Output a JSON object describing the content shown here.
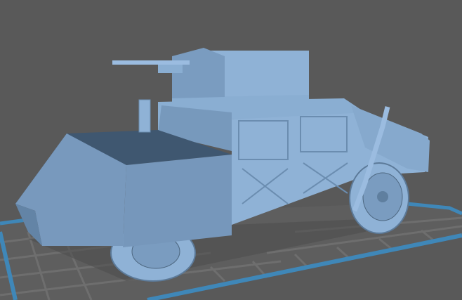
{
  "viewport": {
    "background_color": "#595959",
    "plate_border_color": "#3f87b8",
    "plate_grid_color": "#6b6b6b",
    "model_color_light": "#8fb2d6",
    "model_color_mid": "#7899bd",
    "model_color_dark": "#3f5770",
    "model_name_icon": "humvee-3d-model"
  }
}
